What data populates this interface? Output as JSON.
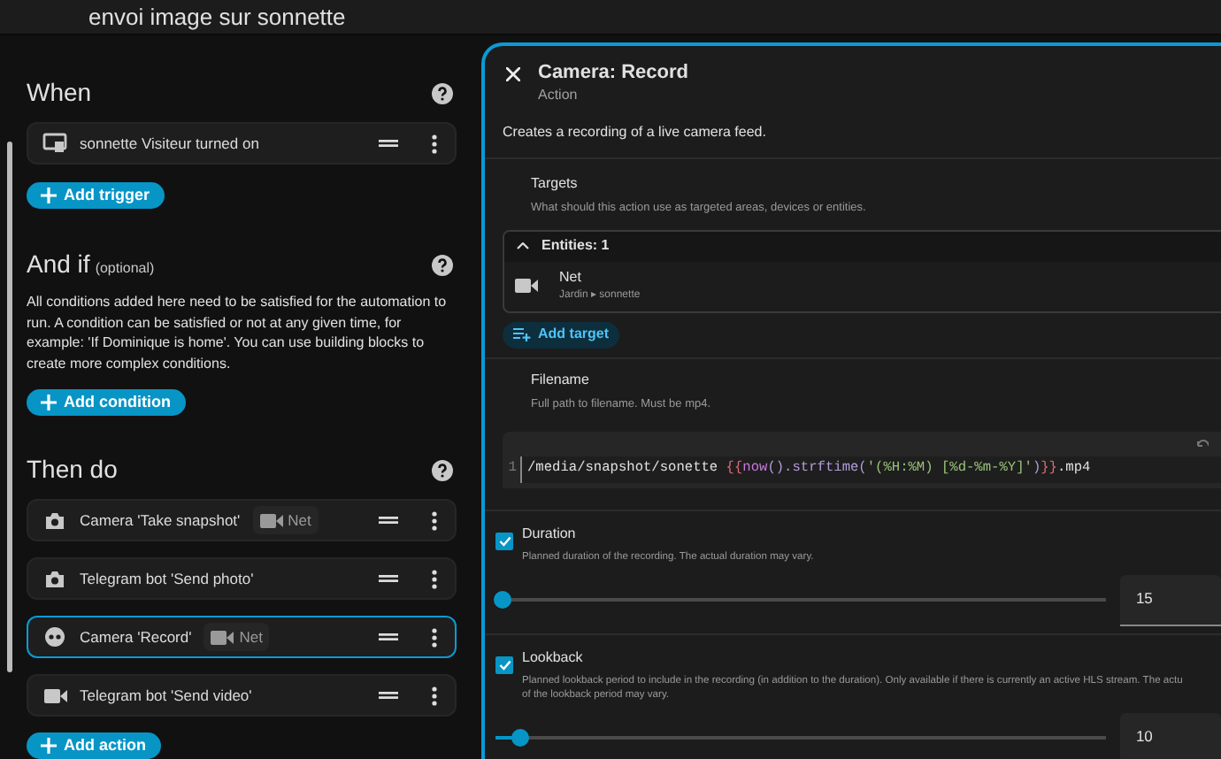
{
  "header": {
    "title": "envoi image sur sonnette"
  },
  "when": {
    "title": "When",
    "items": [
      {
        "kind": "device",
        "label": "sonnette Visiteur turned on",
        "selected": false
      }
    ],
    "add_button": "Add trigger"
  },
  "and_if": {
    "title": "And if",
    "note": "(optional)",
    "description": "All conditions added here need to be satisfied for the automation to run. A condition can be satisfied or not at any given time, for example: 'If Dominique is home'. You can use building blocks to create more complex conditions.",
    "add_button": "Add condition"
  },
  "then_do": {
    "title": "Then do",
    "items": [
      {
        "kind": "camera",
        "label": "Camera 'Take snapshot'",
        "chip": "Net",
        "selected": false
      },
      {
        "kind": "camera",
        "label": "Telegram bot 'Send photo'",
        "selected": false
      },
      {
        "kind": "record",
        "label": "Camera 'Record'",
        "chip": "Net",
        "selected": true
      },
      {
        "kind": "video",
        "label": "Telegram bot 'Send video'",
        "selected": false
      }
    ],
    "add_button": "Add action"
  },
  "editor": {
    "title": "Camera: Record",
    "subtitle": "Action",
    "description": "Creates a recording of a live camera feed.",
    "targets": {
      "label": "Targets",
      "hint": "What should this action use as targeted areas, devices or entities.",
      "group": "Entities: 1",
      "expanded": true,
      "entities": [
        {
          "name": "Net",
          "path": "Jardin ▸ sonnette"
        }
      ],
      "add_button": "Add target"
    },
    "filename": {
      "label": "Filename",
      "hint": "Full path to filename. Must be mp4.",
      "line_number": "1",
      "code": [
        {
          "kind": "plain",
          "text": "/media/snapshot/sonette "
        },
        {
          "kind": "brace",
          "text": "{{"
        },
        {
          "kind": "func",
          "text": "now"
        },
        {
          "kind": "punct",
          "text": "().strftime("
        },
        {
          "kind": "string",
          "text": "'(%H:%M) [%d-%m-%Y]'"
        },
        {
          "kind": "punct",
          "text": ")"
        },
        {
          "kind": "brace",
          "text": "}}"
        },
        {
          "kind": "plain",
          "text": ".mp4"
        }
      ]
    },
    "options": [
      {
        "label": "Duration",
        "checked": true,
        "hint": [
          "Planned duration of the recording. The actual duration may vary."
        ],
        "level": 0.0,
        "value": "15"
      },
      {
        "label": "Lookback",
        "checked": true,
        "hint": [
          "Planned lookback period to include in the recording (in addition to the duration). Only available if there is currently an active HLS stream. The actu",
          "of the lookback period may vary."
        ],
        "level": 0.03,
        "value": "10"
      }
    ]
  }
}
